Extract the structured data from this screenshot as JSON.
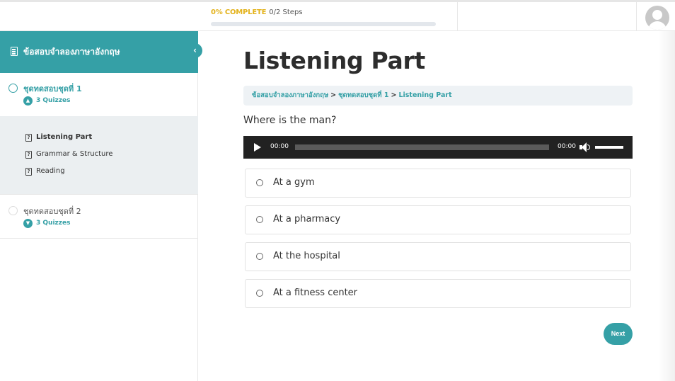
{
  "progress": {
    "percent_label": "0% COMPLETE",
    "steps_label": "0/2 Steps",
    "fraction": 0
  },
  "sidebar": {
    "course_title": "ข้อสอบจำลองภาษาอังกฤษ",
    "sections": [
      {
        "title": "ชุดทดสอบชุดที่ 1",
        "quiz_count": "3 Quizzes",
        "expanded": true,
        "lessons": [
          {
            "label": "Listening Part",
            "active": true
          },
          {
            "label": "Grammar & Structure",
            "active": false
          },
          {
            "label": "Reading",
            "active": false
          }
        ]
      },
      {
        "title": "ชุดทดสอบชุดที่ 2",
        "quiz_count": "3 Quizzes",
        "expanded": false
      }
    ]
  },
  "main": {
    "title": "Listening Part",
    "breadcrumb": [
      "ข้อสอบจำลองภาษาอังกฤษ",
      "ชุดทดสอบชุดที่ 1",
      "Listening Part"
    ],
    "breadcrumb_separator": ">",
    "question": "Where is the man?",
    "player": {
      "current_time": "00:00",
      "duration": "00:00"
    },
    "answers": [
      {
        "label": "At a gym"
      },
      {
        "label": "At a pharmacy"
      },
      {
        "label": "At the hospital"
      },
      {
        "label": "At a fitness center"
      }
    ],
    "next_label": "Next"
  },
  "colors": {
    "accent": "#35a0a6",
    "progress_label": "#e3b21b",
    "player_bg": "#222222",
    "lesson_bg": "#ebeff1"
  }
}
